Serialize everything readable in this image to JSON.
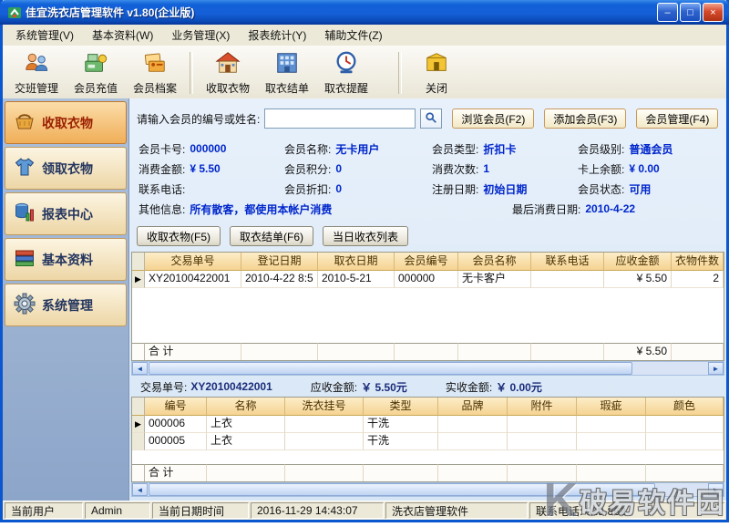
{
  "window": {
    "title": "佳宜洗衣店管理软件  v1.80(企业版)",
    "min": "–",
    "max": "□",
    "close": "×"
  },
  "menu": {
    "items": [
      "系统管理(V)",
      "基本资料(W)",
      "业务管理(X)",
      "报表统计(Y)",
      "辅助文件(Z)"
    ]
  },
  "toolbar": {
    "buttons": [
      "交班管理",
      "会员充值",
      "会员档案",
      "收取衣物",
      "取衣结单",
      "取衣提醒",
      "关闭"
    ]
  },
  "sidebar": {
    "items": [
      "收取衣物",
      "领取衣物",
      "报表中心",
      "基本资料",
      "系统管理"
    ]
  },
  "search": {
    "label": "请输入会员的编号或姓名:",
    "value": "",
    "browse": "浏览会员(F2)",
    "add": "添加会员(F3)",
    "manage": "会员管理(F4)"
  },
  "member": {
    "rows": [
      [
        {
          "label": "会员卡号:",
          "value": "000000"
        },
        {
          "label": "会员名称:",
          "value": "无卡用户"
        },
        {
          "label": "会员类型:",
          "value": "折扣卡"
        },
        {
          "label": "会员级别:",
          "value": "普通会员"
        }
      ],
      [
        {
          "label": "消费金额:",
          "value": "¥ 5.50"
        },
        {
          "label": "会员积分:",
          "value": "0"
        },
        {
          "label": "消费次数:",
          "value": "1"
        },
        {
          "label": "卡上余额:",
          "value": "¥ 0.00"
        }
      ],
      [
        {
          "label": "联系电话:",
          "value": ""
        },
        {
          "label": "会员折扣:",
          "value": "0"
        },
        {
          "label": "注册日期:",
          "value": "初始日期"
        },
        {
          "label": "会员状态:",
          "value": "可用"
        }
      ],
      [
        {
          "label": "其他信息:",
          "value": "所有散客，都使用本帐户消费"
        },
        {
          "label": "最后消费日期:",
          "value": "2010-4-22"
        }
      ]
    ]
  },
  "actions": {
    "collect": "收取衣物(F5)",
    "settle": "取衣结单(F6)",
    "daylist": "当日收衣列表"
  },
  "table1": {
    "headers": [
      "交易单号",
      "登记日期",
      "取衣日期",
      "会员编号",
      "会员名称",
      "联系电话",
      "应收金额",
      "衣物件数"
    ],
    "rows": [
      [
        "XY20100422001",
        "2010-4-22 8:5",
        "2010-5-21",
        "000000",
        "无卡客户",
        "",
        "¥ 5.50",
        "2"
      ]
    ],
    "total_label": "合  计",
    "total_amount": "¥ 5.50"
  },
  "dealinfo": {
    "no_label": "交易单号:",
    "no": "XY20100422001",
    "receivable_label": "应收金额:",
    "receivable": "￥ 5.50元",
    "received_label": "实收金额:",
    "received": "￥ 0.00元"
  },
  "table2": {
    "headers": [
      "编号",
      "名称",
      "洗衣挂号",
      "类型",
      "品牌",
      "附件",
      "瑕疵",
      "颜色"
    ],
    "rows": [
      [
        "000006",
        "上衣",
        "",
        "干洗",
        "",
        "",
        "",
        ""
      ],
      [
        "000005",
        "上衣",
        "",
        "干洗",
        "",
        "",
        "",
        ""
      ]
    ],
    "total_label": "合  计"
  },
  "statusbar": {
    "segments": [
      "当前用户",
      "Admin",
      "当前日期时间",
      "2016-11-29 14:43:07",
      "洗衣店管理软件",
      "联系电话: 029-862"
    ]
  },
  "icons": {
    "row_marker": "▶",
    "scroll_left": "◄",
    "scroll_right": "►"
  },
  "watermark": {
    "big": "K",
    "text": "破易软件园"
  }
}
